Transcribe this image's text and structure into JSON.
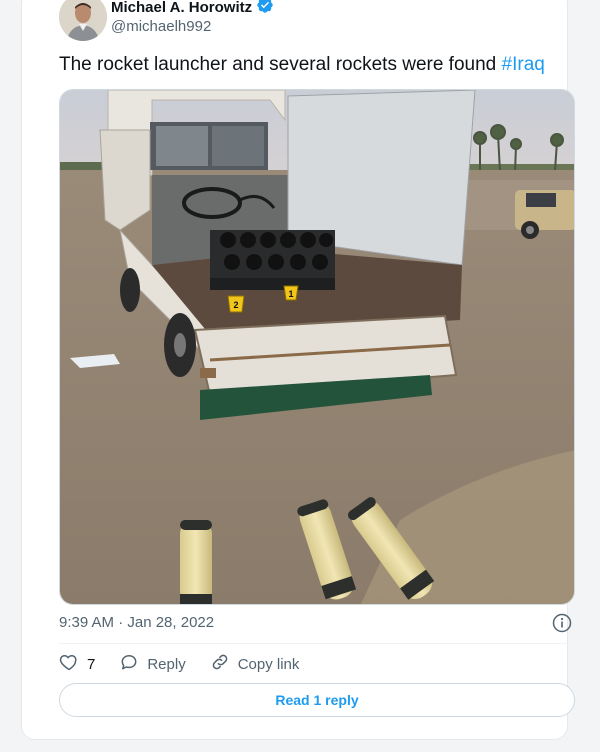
{
  "author": {
    "display_name": "Michael A. Horowitz",
    "handle": "@michaelh992",
    "verified": true
  },
  "tweet": {
    "text": "The rocket launcher and several rockets were found",
    "hashtag": "#Iraq",
    "timestamp": "9:39 AM · Jan 28, 2022"
  },
  "media": {
    "description_icon": "photo",
    "evidence_markers": [
      "1",
      "2"
    ]
  },
  "actions": {
    "like_count": "7",
    "reply_label": "Reply",
    "copy_link_label": "Copy link"
  },
  "read_replies_label": "Read 1 reply",
  "colors": {
    "accent": "#1d9bf0",
    "secondary_text": "#536471",
    "border": "#cfd9de"
  }
}
